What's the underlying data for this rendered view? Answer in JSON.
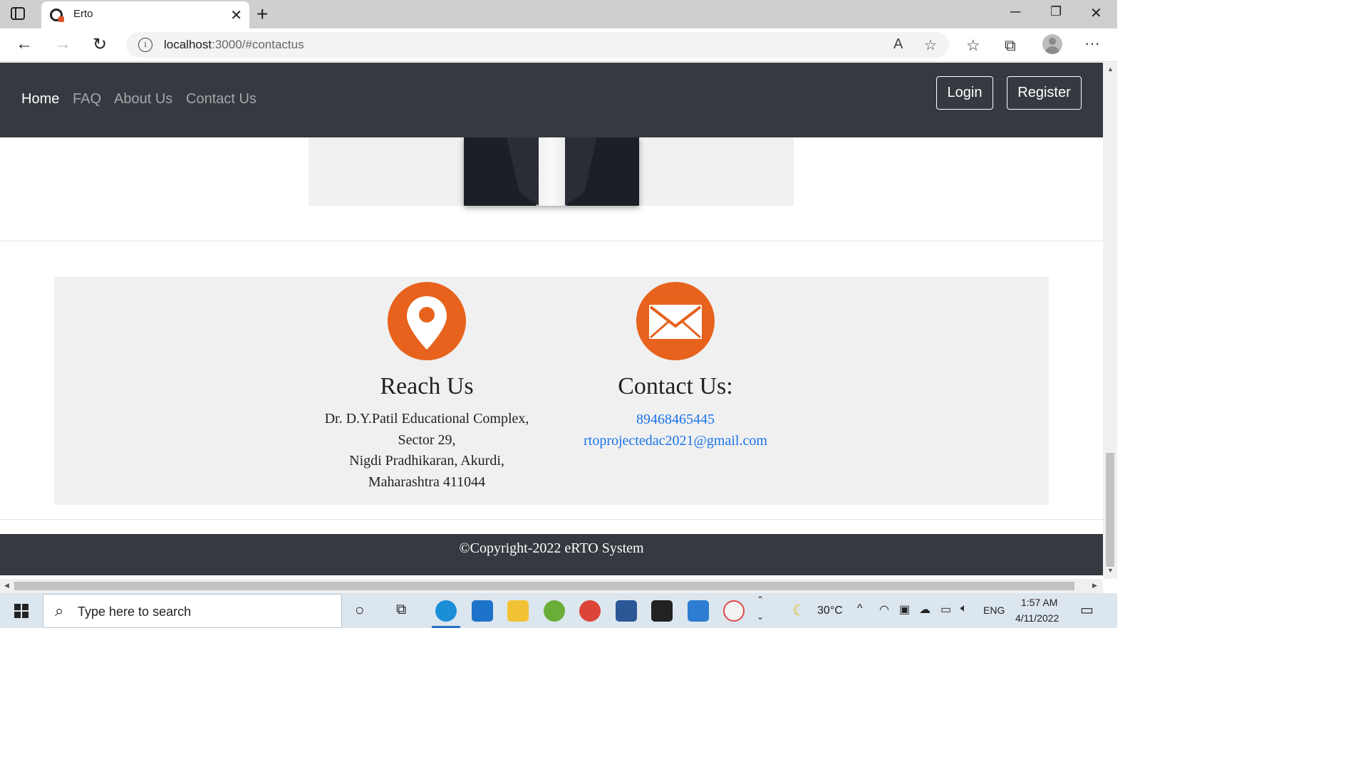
{
  "browser": {
    "tab_title": "Erto",
    "url_host": "localhost",
    "url_rest": ":3000/#contactus"
  },
  "navbar": {
    "links": [
      "Home",
      "FAQ",
      "About Us",
      "Contact Us"
    ],
    "login_label": "Login",
    "register_label": "Register"
  },
  "reach": {
    "heading": "Reach Us",
    "address_lines": [
      "Dr. D.Y.Patil Educational Complex,",
      "Sector 29,",
      "Nigdi Pradhikaran, Akurdi,",
      "Maharashtra 411044"
    ]
  },
  "contact": {
    "heading": "Contact Us:",
    "phone": "89468465445",
    "email": "rtoprojectedac2021@gmail.com"
  },
  "footer": {
    "text": "©Copyright-2022 eRTO System"
  },
  "colors": {
    "navbar_bg": "#343a40",
    "accent_orange": "#e7621c",
    "link_blue": "#1a73e8",
    "panel_bg": "#f0f0f1"
  },
  "taskbar": {
    "search_placeholder": "Type here to search",
    "temperature": "30°C",
    "language": "ENG",
    "time": "1:57 AM",
    "date": "4/11/2022"
  }
}
